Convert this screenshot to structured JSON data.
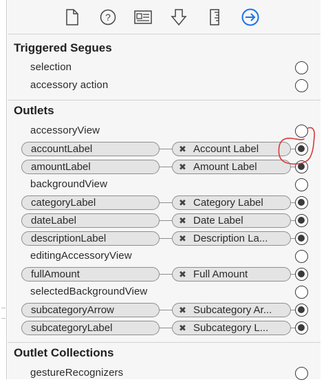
{
  "toolbar": {
    "icons": [
      "file-inspector-icon",
      "help-icon",
      "identity-inspector-icon",
      "attributes-inspector-icon",
      "size-inspector-icon",
      "connections-inspector-icon"
    ],
    "active_color": "#1a73e8"
  },
  "triggered_segues": {
    "header": "Triggered Segues",
    "items": [
      {
        "label": "selection"
      },
      {
        "label": "accessory action"
      }
    ]
  },
  "outlets": {
    "header": "Outlets",
    "items": [
      {
        "label": "accessoryView",
        "connected": false
      },
      {
        "label": "accountLabel",
        "connected": true,
        "target": "Account Label"
      },
      {
        "label": "amountLabel",
        "connected": true,
        "target": "Amount Label"
      },
      {
        "label": "backgroundView",
        "connected": false
      },
      {
        "label": "categoryLabel",
        "connected": true,
        "target": "Category Label"
      },
      {
        "label": "dateLabel",
        "connected": true,
        "target": "Date Label"
      },
      {
        "label": "descriptionLabel",
        "connected": true,
        "target": "Description La..."
      },
      {
        "label": "editingAccessoryView",
        "connected": false
      },
      {
        "label": "fullAmount",
        "connected": true,
        "target": "Full Amount"
      },
      {
        "label": "selectedBackgroundView",
        "connected": false
      },
      {
        "label": "subcategoryArrow",
        "connected": true,
        "target": "Subcategory Ar..."
      },
      {
        "label": "subcategoryLabel",
        "connected": true,
        "target": "Subcategory L..."
      }
    ]
  },
  "outlet_collections": {
    "header": "Outlet Collections",
    "items": [
      {
        "label": "gestureRecognizers"
      }
    ]
  },
  "annotation_color": "#d93a3a"
}
